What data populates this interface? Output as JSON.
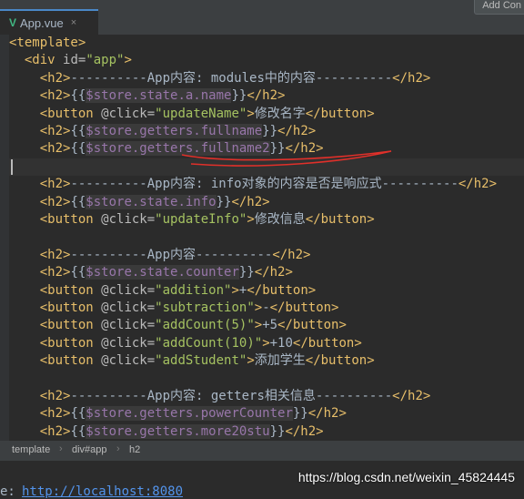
{
  "tabs": [
    {
      "label": "App.vue",
      "icon": "vue-icon",
      "close": "×"
    }
  ],
  "add_config_label": "Add Con",
  "code_lines": [
    [
      {
        "c": "tag",
        "t": "<template>"
      }
    ],
    [
      {
        "c": "txt",
        "t": "  "
      },
      {
        "c": "tag",
        "t": "<div "
      },
      {
        "c": "attr",
        "t": "id="
      },
      {
        "c": "str",
        "t": "\"app\""
      },
      {
        "c": "tag",
        "t": ">"
      }
    ],
    [
      {
        "c": "txt",
        "t": "    "
      },
      {
        "c": "tag",
        "t": "<h2>"
      },
      {
        "c": "txt",
        "t": "----------App内容: modules中的内容----------"
      },
      {
        "c": "tag",
        "t": "</h2>"
      }
    ],
    [
      {
        "c": "txt",
        "t": "    "
      },
      {
        "c": "tag",
        "t": "<h2>"
      },
      {
        "c": "txt",
        "t": "{{"
      },
      {
        "c": "mus",
        "t": "$store.state.a.name"
      },
      {
        "c": "txt",
        "t": "}}"
      },
      {
        "c": "tag",
        "t": "</h2>"
      }
    ],
    [
      {
        "c": "txt",
        "t": "    "
      },
      {
        "c": "tag",
        "t": "<button "
      },
      {
        "c": "attr",
        "t": "@click="
      },
      {
        "c": "str",
        "t": "\"updateName\""
      },
      {
        "c": "tag",
        "t": ">"
      },
      {
        "c": "txt",
        "t": "修改名字"
      },
      {
        "c": "tag",
        "t": "</button>"
      }
    ],
    [
      {
        "c": "txt",
        "t": "    "
      },
      {
        "c": "tag",
        "t": "<h2>"
      },
      {
        "c": "txt",
        "t": "{{"
      },
      {
        "c": "mus",
        "t": "$store.getters.fullname"
      },
      {
        "c": "txt",
        "t": "}}"
      },
      {
        "c": "tag",
        "t": "</h2>"
      }
    ],
    [
      {
        "c": "txt",
        "t": "    "
      },
      {
        "c": "tag",
        "t": "<h2>"
      },
      {
        "c": "txt",
        "t": "{{"
      },
      {
        "c": "mus",
        "t": "$store.getters.fullname2"
      },
      {
        "c": "txt",
        "t": "}}"
      },
      {
        "c": "tag",
        "t": "</h2>"
      }
    ],
    [],
    [
      {
        "c": "txt",
        "t": "    "
      },
      {
        "c": "tag",
        "t": "<h2>"
      },
      {
        "c": "txt",
        "t": "----------App内容: info对象的内容是否是响应式----------"
      },
      {
        "c": "tag",
        "t": "</h2>"
      }
    ],
    [
      {
        "c": "txt",
        "t": "    "
      },
      {
        "c": "tag",
        "t": "<h2>"
      },
      {
        "c": "txt",
        "t": "{{"
      },
      {
        "c": "mus",
        "t": "$store.state.info"
      },
      {
        "c": "txt",
        "t": "}}"
      },
      {
        "c": "tag",
        "t": "</h2>"
      }
    ],
    [
      {
        "c": "txt",
        "t": "    "
      },
      {
        "c": "tag",
        "t": "<button "
      },
      {
        "c": "attr",
        "t": "@click="
      },
      {
        "c": "str",
        "t": "\"updateInfo\""
      },
      {
        "c": "tag",
        "t": ">"
      },
      {
        "c": "txt",
        "t": "修改信息"
      },
      {
        "c": "tag",
        "t": "</button>"
      }
    ],
    [],
    [
      {
        "c": "txt",
        "t": "    "
      },
      {
        "c": "tag",
        "t": "<h2>"
      },
      {
        "c": "txt",
        "t": "----------App内容----------"
      },
      {
        "c": "tag",
        "t": "</h2>"
      }
    ],
    [
      {
        "c": "txt",
        "t": "    "
      },
      {
        "c": "tag",
        "t": "<h2>"
      },
      {
        "c": "txt",
        "t": "{{"
      },
      {
        "c": "mus",
        "t": "$store.state.counter"
      },
      {
        "c": "txt",
        "t": "}}"
      },
      {
        "c": "tag",
        "t": "</h2>"
      }
    ],
    [
      {
        "c": "txt",
        "t": "    "
      },
      {
        "c": "tag",
        "t": "<button "
      },
      {
        "c": "attr",
        "t": "@click="
      },
      {
        "c": "str",
        "t": "\"addition\""
      },
      {
        "c": "tag",
        "t": ">"
      },
      {
        "c": "txt",
        "t": "+"
      },
      {
        "c": "tag",
        "t": "</button>"
      }
    ],
    [
      {
        "c": "txt",
        "t": "    "
      },
      {
        "c": "tag",
        "t": "<button "
      },
      {
        "c": "attr",
        "t": "@click="
      },
      {
        "c": "str",
        "t": "\"subtraction\""
      },
      {
        "c": "tag",
        "t": ">"
      },
      {
        "c": "txt",
        "t": "-"
      },
      {
        "c": "tag",
        "t": "</button>"
      }
    ],
    [
      {
        "c": "txt",
        "t": "    "
      },
      {
        "c": "tag",
        "t": "<button "
      },
      {
        "c": "attr",
        "t": "@click="
      },
      {
        "c": "str",
        "t": "\"addCount(5)\""
      },
      {
        "c": "tag",
        "t": ">"
      },
      {
        "c": "txt",
        "t": "+5"
      },
      {
        "c": "tag",
        "t": "</button>"
      }
    ],
    [
      {
        "c": "txt",
        "t": "    "
      },
      {
        "c": "tag",
        "t": "<button "
      },
      {
        "c": "attr",
        "t": "@click="
      },
      {
        "c": "str",
        "t": "\"addCount(10)\""
      },
      {
        "c": "tag",
        "t": ">"
      },
      {
        "c": "txt",
        "t": "+10"
      },
      {
        "c": "tag",
        "t": "</button>"
      }
    ],
    [
      {
        "c": "txt",
        "t": "    "
      },
      {
        "c": "tag",
        "t": "<button "
      },
      {
        "c": "attr",
        "t": "@click="
      },
      {
        "c": "str",
        "t": "\"addStudent\""
      },
      {
        "c": "tag",
        "t": ">"
      },
      {
        "c": "txt",
        "t": "添加学生"
      },
      {
        "c": "tag",
        "t": "</button>"
      }
    ],
    [],
    [
      {
        "c": "txt",
        "t": "    "
      },
      {
        "c": "tag",
        "t": "<h2>"
      },
      {
        "c": "txt",
        "t": "----------App内容: getters相关信息----------"
      },
      {
        "c": "tag",
        "t": "</h2>"
      }
    ],
    [
      {
        "c": "txt",
        "t": "    "
      },
      {
        "c": "tag",
        "t": "<h2>"
      },
      {
        "c": "txt",
        "t": "{{"
      },
      {
        "c": "mus",
        "t": "$store.getters.powerCounter"
      },
      {
        "c": "txt",
        "t": "}}"
      },
      {
        "c": "tag",
        "t": "</h2>"
      }
    ],
    [
      {
        "c": "txt",
        "t": "    "
      },
      {
        "c": "tag",
        "t": "<h2>"
      },
      {
        "c": "txt",
        "t": "{{"
      },
      {
        "c": "mus",
        "t": "$store.getters.more20stu"
      },
      {
        "c": "txt",
        "t": "}}"
      },
      {
        "c": "tag",
        "t": "</h2>"
      }
    ]
  ],
  "cursor_line_index": 7,
  "breadcrumb": [
    "template",
    "div#app",
    "h2"
  ],
  "breadcrumb_sep": "›",
  "run": {
    "label": "e:",
    "link": "http://localhost:8080"
  },
  "watermark": "https://blog.csdn.net/weixin_45824445",
  "colors": {
    "tag": "#e8bf6a",
    "string": "#a5c261",
    "mustache": "#9876aa",
    "annotation": "#e0302a"
  }
}
